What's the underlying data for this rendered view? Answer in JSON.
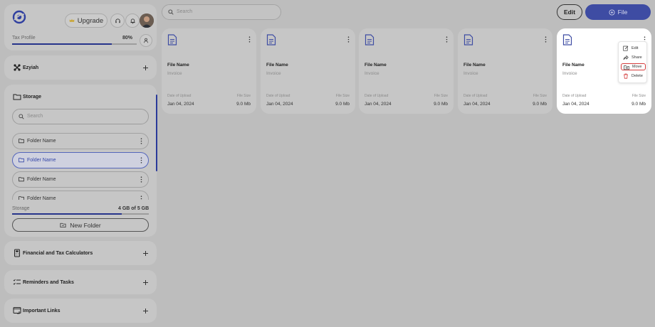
{
  "header": {
    "upgrade_label": "Upgrade",
    "tax_profile_label": "Tax Profile",
    "tax_profile_pct": "80%",
    "tax_profile_progress": 0.8
  },
  "sidebar": {
    "ezyiah_label": "Ezyiah",
    "storage": {
      "title": "Storage",
      "search_placeholder": "Search",
      "folders": [
        "Folder Name",
        "Folder Name",
        "Folder Name",
        "Folder Name"
      ],
      "active_folder_index": 1,
      "usage_label": "Storage",
      "usage_value": "4 GB of 5  GB",
      "usage_progress": 0.8,
      "new_folder_label": "New Folder"
    },
    "calculators_label": "Financial and Tax Calculators",
    "reminders_label": "Reminders and Tasks",
    "links_label": "Important Links"
  },
  "topbar": {
    "search_placeholder": "Search",
    "edit_label": "Edit",
    "file_label": "File"
  },
  "files": [
    {
      "name": "File Name",
      "type": "Invoice",
      "date_label": "Date of Upload",
      "size_label": "File Size",
      "date": "Jan 04, 2024",
      "size": "9.0 Mb"
    },
    {
      "name": "File Name",
      "type": "Invoice",
      "date_label": "Date of Upload",
      "size_label": "File Size",
      "date": "Jan 04, 2024",
      "size": "9.0 Mb"
    },
    {
      "name": "File Name",
      "type": "Invoice",
      "date_label": "Date of Upload",
      "size_label": "File Size",
      "date": "Jan 04, 2024",
      "size": "9.0 Mb"
    },
    {
      "name": "File Name",
      "type": "Invoice",
      "date_label": "Date of Upload",
      "size_label": "File Size",
      "date": "Jan 04, 2024",
      "size": "9.0 Mb"
    },
    {
      "name": "File Name",
      "type": "Invoice",
      "date_label": "Date of Upload",
      "size_label": "File Size",
      "date": "Jan 04, 2024",
      "size": "9.0 Mb"
    }
  ],
  "context_menu": {
    "items": [
      "Edit",
      "Share",
      "Move",
      "Delete"
    ],
    "highlighted": "Move"
  },
  "colors": {
    "accent": "#27348b",
    "file_button": "#3e4ca3",
    "delete": "#d43c3c"
  }
}
